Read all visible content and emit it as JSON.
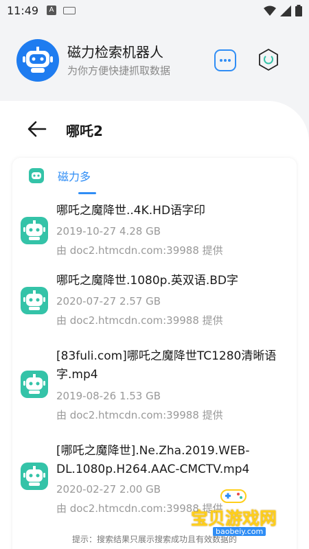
{
  "status": {
    "time": "11:49",
    "notif_letter": "A"
  },
  "header": {
    "title": "磁力检索机器人",
    "subtitle": "为你方便快捷抓取数据"
  },
  "search": {
    "query": "哪吒2"
  },
  "source_tab": {
    "label": "磁力多"
  },
  "results": [
    {
      "name": "哪吒之魔降世..4K.HD语字印",
      "date_size": "2019-10-27  4.28 GB",
      "provider": "由 doc2.htmcdn.com:39988 提供"
    },
    {
      "name": "哪吒之魔降世.1080p.英双语.BD字",
      "date_size": "2020-07-27  2.57 GB",
      "provider": "由 doc2.htmcdn.com:39988 提供"
    },
    {
      "name": "[83fuli.com]哪吒之魔降世TC1280清晰语字.mp4",
      "date_size": "2019-08-26  1.53 GB",
      "provider": "由 doc2.htmcdn.com:39988 提供"
    },
    {
      "name": "[哪吒之魔降世].Ne.Zha.2019.WEB-DL.1080p.H264.AAC-CMCTV.mp4",
      "date_size": "2020-02-27  2.00 GB",
      "provider": "由 doc2.htmcdn.com:39988 提供"
    }
  ],
  "hint": "提示：搜索结果只展示搜索成功且有效数据的",
  "watermark": {
    "text": "宝贝游戏网",
    "url": "baobeiy.com"
  },
  "colors": {
    "accent": "#2f8df5",
    "bot_green": "#34c3a8",
    "bot_blue": "#1e7cf0"
  }
}
